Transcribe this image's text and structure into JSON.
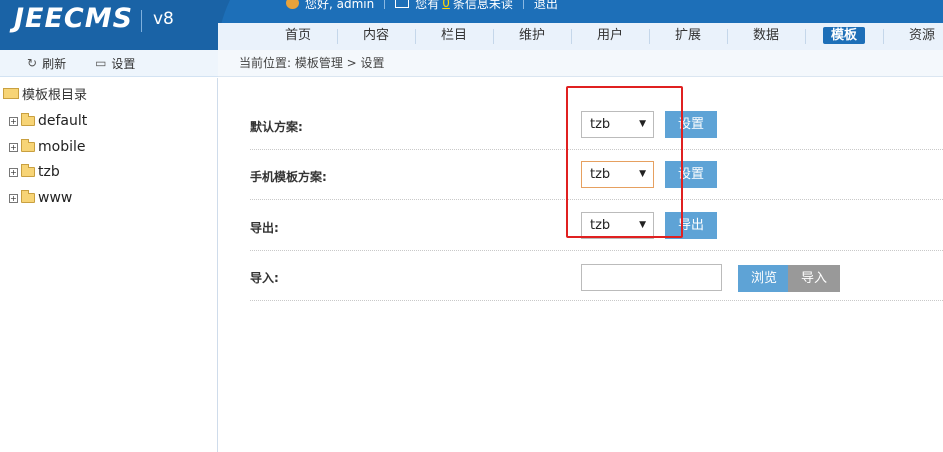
{
  "brand": {
    "name": "JEECMS",
    "version": "v8"
  },
  "topbar": {
    "greeting": "您好, admin",
    "msg_prefix": "您有",
    "msg_count": "0",
    "msg_suffix": "条信息未读",
    "logout": "退出"
  },
  "nav": {
    "items": [
      {
        "label": "首页"
      },
      {
        "label": "内容"
      },
      {
        "label": "栏目"
      },
      {
        "label": "维护"
      },
      {
        "label": "用户"
      },
      {
        "label": "扩展"
      },
      {
        "label": "数据"
      },
      {
        "label": "模板"
      },
      {
        "label": "资源"
      }
    ],
    "active": "模板"
  },
  "toolbar": {
    "refresh": "刷新",
    "settings": "设置"
  },
  "breadcrumb": "当前位置: 模板管理 > 设置",
  "tree": {
    "root": "模板根目录",
    "nodes": [
      {
        "label": "default"
      },
      {
        "label": "mobile"
      },
      {
        "label": "tzb"
      },
      {
        "label": "www"
      }
    ]
  },
  "form": {
    "rows": [
      {
        "label": "默认方案:",
        "select_value": "tzb",
        "button": "设置"
      },
      {
        "label": "手机模板方案:",
        "select_value": "tzb",
        "button": "设置"
      },
      {
        "label": "导出:",
        "select_value": "tzb",
        "button": "导出"
      }
    ],
    "import": {
      "label": "导入:",
      "input_value": "",
      "browse": "浏览",
      "submit": "导入"
    }
  },
  "colors": {
    "header": "#1d6fb8",
    "button": "#5ea3d6",
    "highlight_box": "#e02020"
  }
}
